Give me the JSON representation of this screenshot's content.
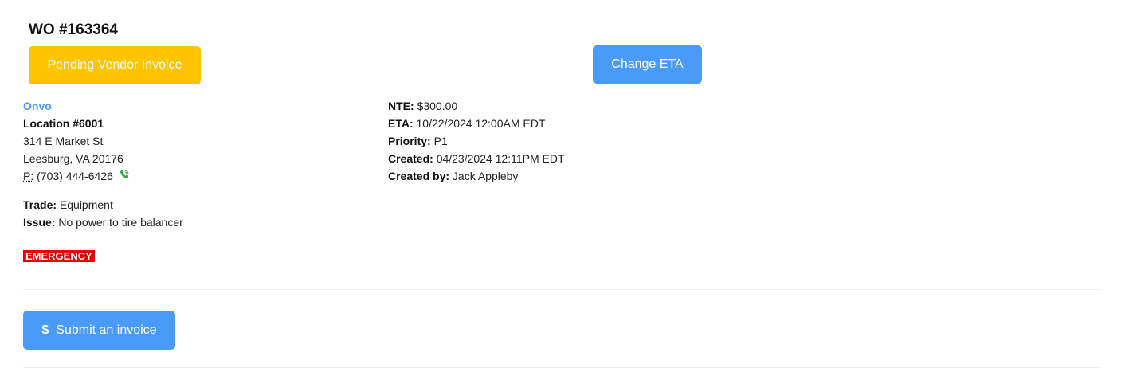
{
  "work_order": {
    "title": "WO #163364",
    "status_label": "Pending Vendor Invoice",
    "change_eta_label": "Change ETA"
  },
  "location": {
    "client": "Onvo",
    "name": "Location #6001",
    "address_line1": "314 E Market St",
    "address_line2": "Leesburg, VA 20176",
    "phone_prefix": "P:",
    "phone": "(703) 444-6426"
  },
  "details": {
    "trade_label": "Trade:",
    "trade_value": "Equipment",
    "issue_label": "Issue:",
    "issue_value": "No power to tire balancer",
    "emergency_badge": "EMERGENCY"
  },
  "meta": {
    "nte_label": "NTE:",
    "nte_value": "$300.00",
    "eta_label": "ETA:",
    "eta_value": "10/22/2024 12:00AM EDT",
    "priority_label": "Priority:",
    "priority_value": "P1",
    "created_label": "Created:",
    "created_value": "04/23/2024 12:11PM EDT",
    "created_by_label": "Created by:",
    "created_by_value": "Jack Appleby"
  },
  "actions": {
    "submit_invoice_label": "Submit an invoice",
    "submit_invoice_icon": "dollar-icon"
  },
  "colors": {
    "status_yellow": "#FFC400",
    "primary_blue": "#4A9BF8",
    "emergency_red": "#E80000",
    "phone_icon_green": "#2EA84A"
  }
}
